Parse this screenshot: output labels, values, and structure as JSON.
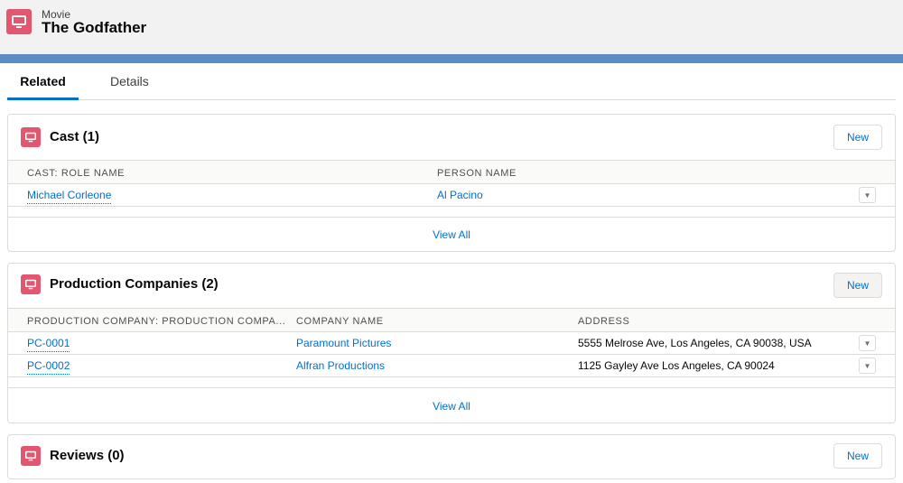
{
  "header": {
    "object_type": "Movie",
    "title": "The Godfather",
    "icon": "monitor-icon"
  },
  "tabs": [
    {
      "label": "Related",
      "active": true
    },
    {
      "label": "Details",
      "active": false
    }
  ],
  "cast": {
    "title": "Cast (1)",
    "new_label": "New",
    "columns": [
      "CAST: ROLE NAME",
      "PERSON NAME"
    ],
    "rows": [
      {
        "role": "Michael Corleone",
        "person": "Al Pacino"
      }
    ],
    "view_all": "View All"
  },
  "companies": {
    "title": "Production Companies (2)",
    "new_label": "New",
    "columns": [
      "PRODUCTION COMPANY: PRODUCTION COMPA...",
      "COMPANY NAME",
      "ADDRESS"
    ],
    "rows": [
      {
        "id": "PC-0001",
        "name": "Paramount Pictures",
        "address": "5555 Melrose Ave, Los Angeles, CA 90038, USA"
      },
      {
        "id": "PC-0002",
        "name": "Alfran Productions",
        "address": "1125 Gayley Ave Los Angeles, CA 90024"
      }
    ],
    "view_all": "View All"
  },
  "reviews": {
    "title": "Reviews (0)",
    "new_label": "New"
  },
  "colors": {
    "accent": "#0070d2",
    "icon_bg": "#e3566f",
    "band": "#5b8cc4"
  }
}
